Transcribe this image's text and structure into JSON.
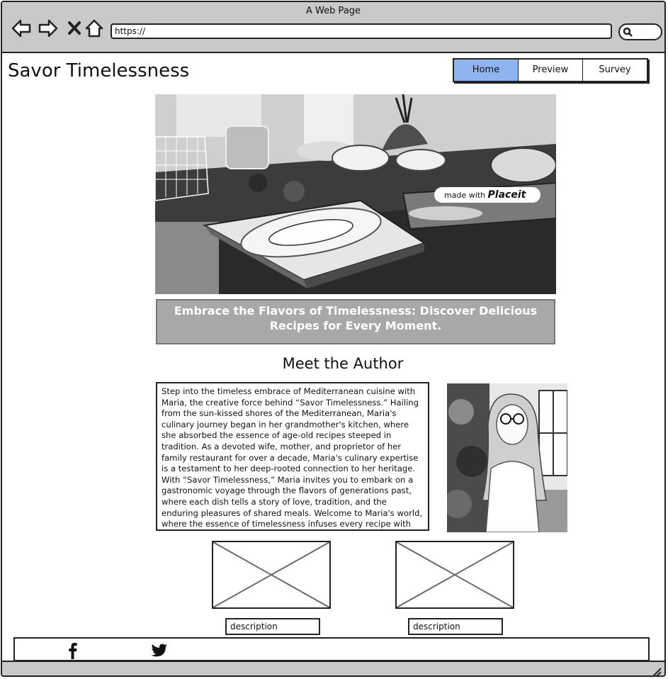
{
  "window": {
    "title": "A Web Page"
  },
  "browser": {
    "url": "https://",
    "icons": [
      "back-arrow-icon",
      "forward-arrow-icon",
      "close-icon",
      "home-icon",
      "search-icon"
    ]
  },
  "site": {
    "title": "Savor Timelessness"
  },
  "nav": {
    "tabs": [
      {
        "label": "Home",
        "active": true
      },
      {
        "label": "Preview",
        "active": false
      },
      {
        "label": "Survey",
        "active": false
      }
    ]
  },
  "hero": {
    "badge_prefix": "made with",
    "badge_brand": "Placeit"
  },
  "tagline": "Embrace the Flavors of Timelessness: Discover Delicious Recipes for Every Moment.",
  "author": {
    "heading": "Meet the Author",
    "bio": "Step into the timeless embrace of Mediterranean cuisine with Maria, the creative force behind “Savor Timelessness.” Hailing from the sun-kissed shores of the Mediterranean, Maria's culinary journey began in her grandmother's kitchen, where she absorbed the essence of age-old recipes steeped in tradition. As a devoted wife, mother, and proprietor of her family restaurant for over a decade, Maria's culinary expertise is a testament to her deep-rooted connection to her heritage. With “Savor Timelessness,” Maria invites you to embark on a gastronomic voyage through the flavors of generations past, where each dish tells a story of love, tradition, and the enduring pleasures of shared meals. Welcome to Maria's world, where the essence of timelessness infuses every recipe with warmth"
  },
  "gallery": [
    {
      "description": "description"
    },
    {
      "description": "description"
    }
  ],
  "footer": {
    "icons": [
      "facebook-icon",
      "twitter-icon"
    ]
  },
  "colors": {
    "chrome": "#c9c9c9",
    "active_tab": "#8fb5f0",
    "tagline_bg": "#a8a8a8"
  }
}
